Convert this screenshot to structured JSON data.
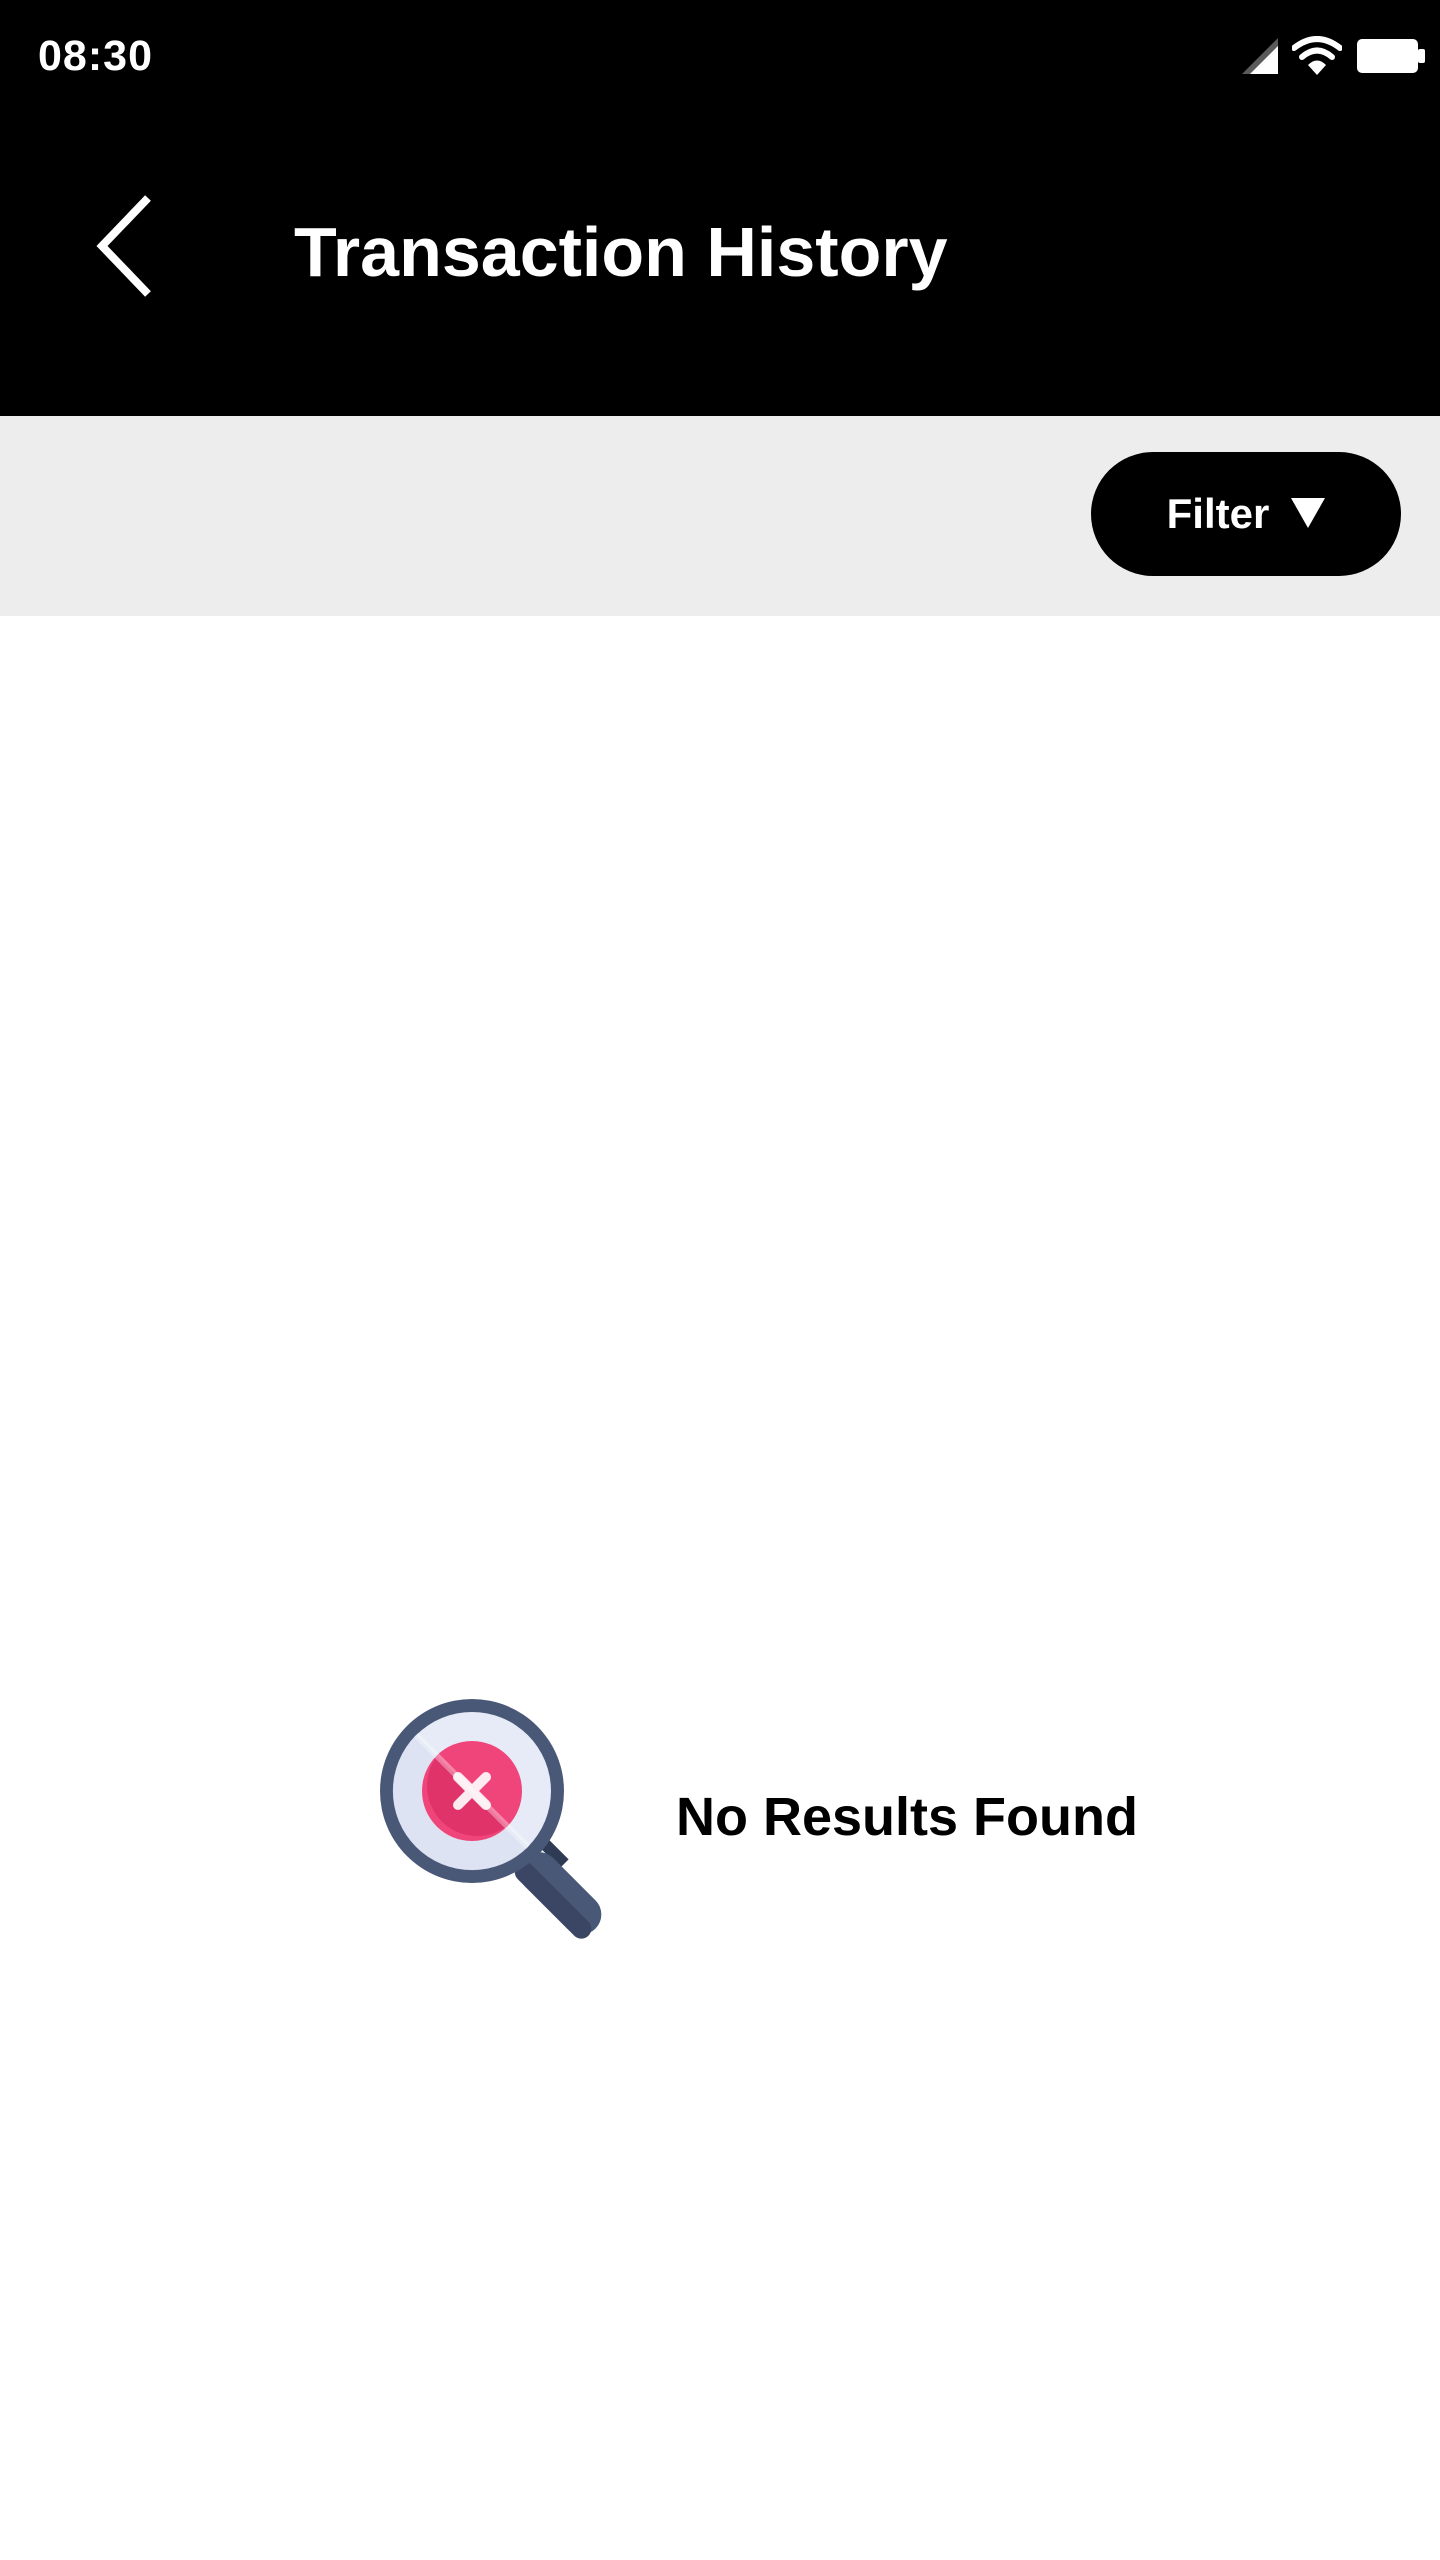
{
  "status_bar": {
    "time": "08:30",
    "icons": [
      "signal-icon",
      "wifi-icon",
      "battery-icon"
    ]
  },
  "header": {
    "title": "Transaction History",
    "back_icon": "chevron-left-icon"
  },
  "filter": {
    "label": "Filter",
    "caret": "▼"
  },
  "empty_state": {
    "icon": "search-no-results-icon",
    "message": "No Results Found"
  },
  "colors": {
    "header_bg": "#000000",
    "filter_bar_bg": "#ededed",
    "filter_button_bg": "#000000",
    "accent_pink": "#f0457a",
    "icon_navy": "#4a5878"
  }
}
